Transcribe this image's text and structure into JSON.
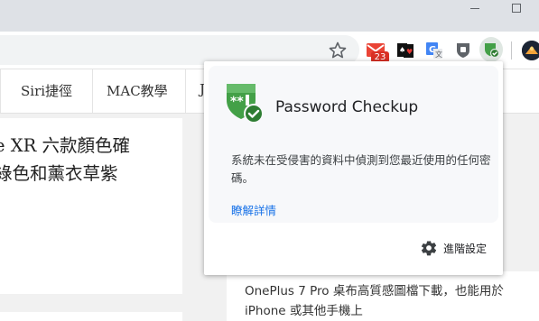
{
  "nav": {
    "items": [
      {
        "label": "Siri捷徑"
      },
      {
        "label": "MAC教學"
      },
      {
        "label": "J"
      }
    ]
  },
  "article": {
    "title": "e XR 六款顏色確\n綠色和薰衣草紫"
  },
  "sidebar": {
    "text": "OnePlus 7 Pro 桌布高質感圖檔下載，也能用於 iPhone 或其他手機上"
  },
  "extensions": {
    "gmail_badge": "23"
  },
  "popup": {
    "title": "Password Checkup",
    "message": "系統未在受侵害的資料中偵測到您最近使用的任何密碼。",
    "link": "瞭解詳情",
    "settings_label": "進階設定"
  },
  "colors": {
    "accent": "#1a73e8",
    "shield_green": "#43a047",
    "badge_red": "#d93025"
  }
}
